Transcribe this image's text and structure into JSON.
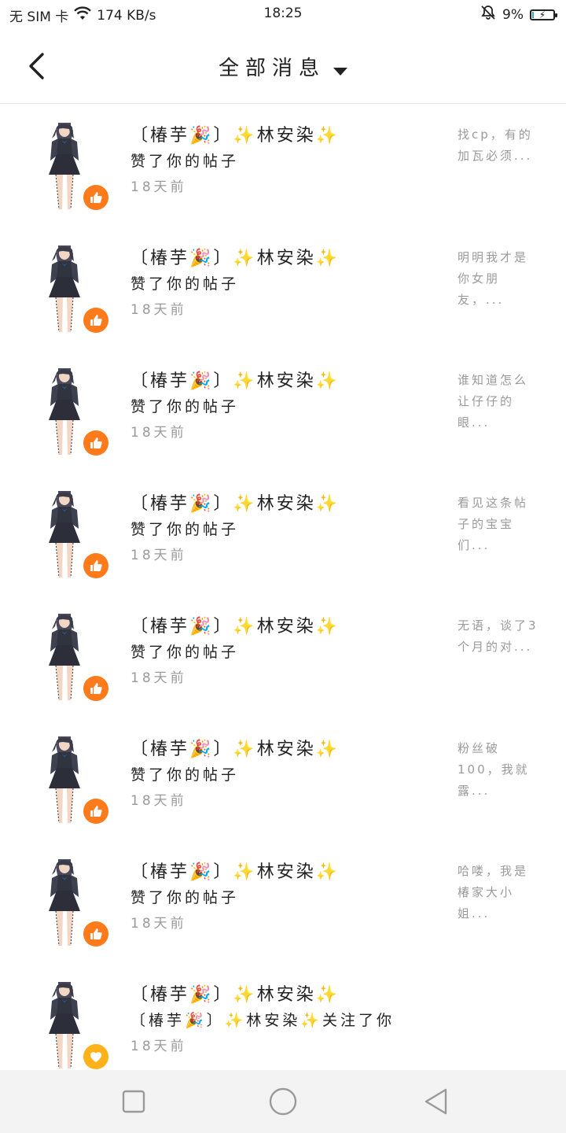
{
  "status_bar": {
    "carrier": "无 SIM 卡",
    "speed": "174 KB/s",
    "time": "18:25",
    "battery": "9%",
    "battery_level": 0.09,
    "icons": [
      "wifi-icon",
      "bell-muted-icon",
      "battery-charging-icon"
    ]
  },
  "header": {
    "title": "全部消息",
    "icons": [
      "back-icon",
      "dropdown-icon"
    ]
  },
  "colors": {
    "like_badge": "#ff7a1a",
    "follow_badge": "#ffb21a",
    "divider": "#e6e6e6",
    "secondary_text": "#9a9a9a",
    "nav_bar_bg": "#f3f3f3"
  },
  "messages": [
    {
      "name": "〔椿芋🎉〕✨林安染✨",
      "action": "赞了你的帖子",
      "time": "18天前",
      "preview": "找cp，有的加瓦必须...",
      "type": "like"
    },
    {
      "name": "〔椿芋🎉〕✨林安染✨",
      "action": "赞了你的帖子",
      "time": "18天前",
      "preview": "明明我才是你女朋友，...",
      "type": "like"
    },
    {
      "name": "〔椿芋🎉〕✨林安染✨",
      "action": "赞了你的帖子",
      "time": "18天前",
      "preview": "谁知道怎么让仔仔的眼...",
      "type": "like"
    },
    {
      "name": "〔椿芋🎉〕✨林安染✨",
      "action": "赞了你的帖子",
      "time": "18天前",
      "preview": "看见这条帖子的宝宝们...",
      "type": "like"
    },
    {
      "name": "〔椿芋🎉〕✨林安染✨",
      "action": "赞了你的帖子",
      "time": "18天前",
      "preview": "无语，谈了3个月的对...",
      "type": "like"
    },
    {
      "name": "〔椿芋🎉〕✨林安染✨",
      "action": "赞了你的帖子",
      "time": "18天前",
      "preview": "粉丝破100，我就露...",
      "type": "like"
    },
    {
      "name": "〔椿芋🎉〕✨林安染✨",
      "action": "赞了你的帖子",
      "time": "18天前",
      "preview": "哈喽，我是椿家大小姐...",
      "type": "like"
    },
    {
      "name": "〔椿芋🎉〕✨林安染✨",
      "action": "〔椿芋🎉〕✨林安染✨关注了你",
      "time": "18天前",
      "preview": "",
      "type": "follow"
    }
  ],
  "nav_bar": {
    "icons": [
      "recent-apps-icon",
      "home-icon",
      "back-nav-icon"
    ]
  }
}
